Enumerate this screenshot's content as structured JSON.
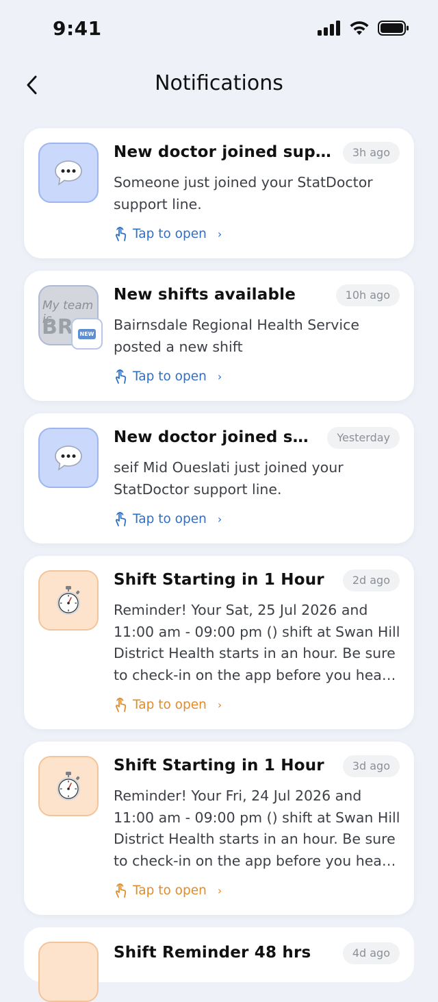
{
  "status_bar": {
    "time": "9:41"
  },
  "header": {
    "title": "Notifications"
  },
  "notifications": [
    {
      "icon": "speech-bubble-icon",
      "title": "New doctor joined support",
      "time": "3h ago",
      "body": "Someone just joined your StatDoctor support line.",
      "action": "Tap to open",
      "style": "blue"
    },
    {
      "icon": "team-image",
      "title": "New shifts available",
      "time": "10h ago",
      "body": "Bairnsdale Regional Health Service posted a new shift",
      "action": "Tap to open",
      "style": "blue",
      "avatar_text_top": "My team is",
      "avatar_text_big": "BRI",
      "badge": "NEW"
    },
    {
      "icon": "speech-bubble-icon",
      "title": "New doctor joined sup…",
      "time": "Yesterday",
      "body": "seif Mid Oueslati just joined your StatDoctor support line.",
      "action": "Tap to open",
      "style": "blue"
    },
    {
      "icon": "stopwatch-icon",
      "title": "Shift Starting in 1 Hour",
      "time": "2d ago",
      "body": "Reminder! Your Sat, 25 Jul 2026 and 11:00 am - 09:00 pm () shift at Swan Hill District Health starts in an hour. Be sure to check-in on the app before you hea…",
      "action": "Tap to open",
      "style": "orange"
    },
    {
      "icon": "stopwatch-icon",
      "title": "Shift Starting in 1 Hour",
      "time": "3d ago",
      "body": "Reminder! Your Fri, 24 Jul 2026 and 11:00 am - 09:00 pm () shift at Swan Hill District Health starts in an hour. Be sure to check-in on the app before you hea…",
      "action": "Tap to open",
      "style": "orange"
    }
  ],
  "partial_notification": {
    "title": "Shift Reminder 48 hrs",
    "time": "4d ago"
  },
  "colors": {
    "background": "#eef2f8",
    "link_blue": "#2f6fc8",
    "link_orange": "#e08c2c"
  }
}
